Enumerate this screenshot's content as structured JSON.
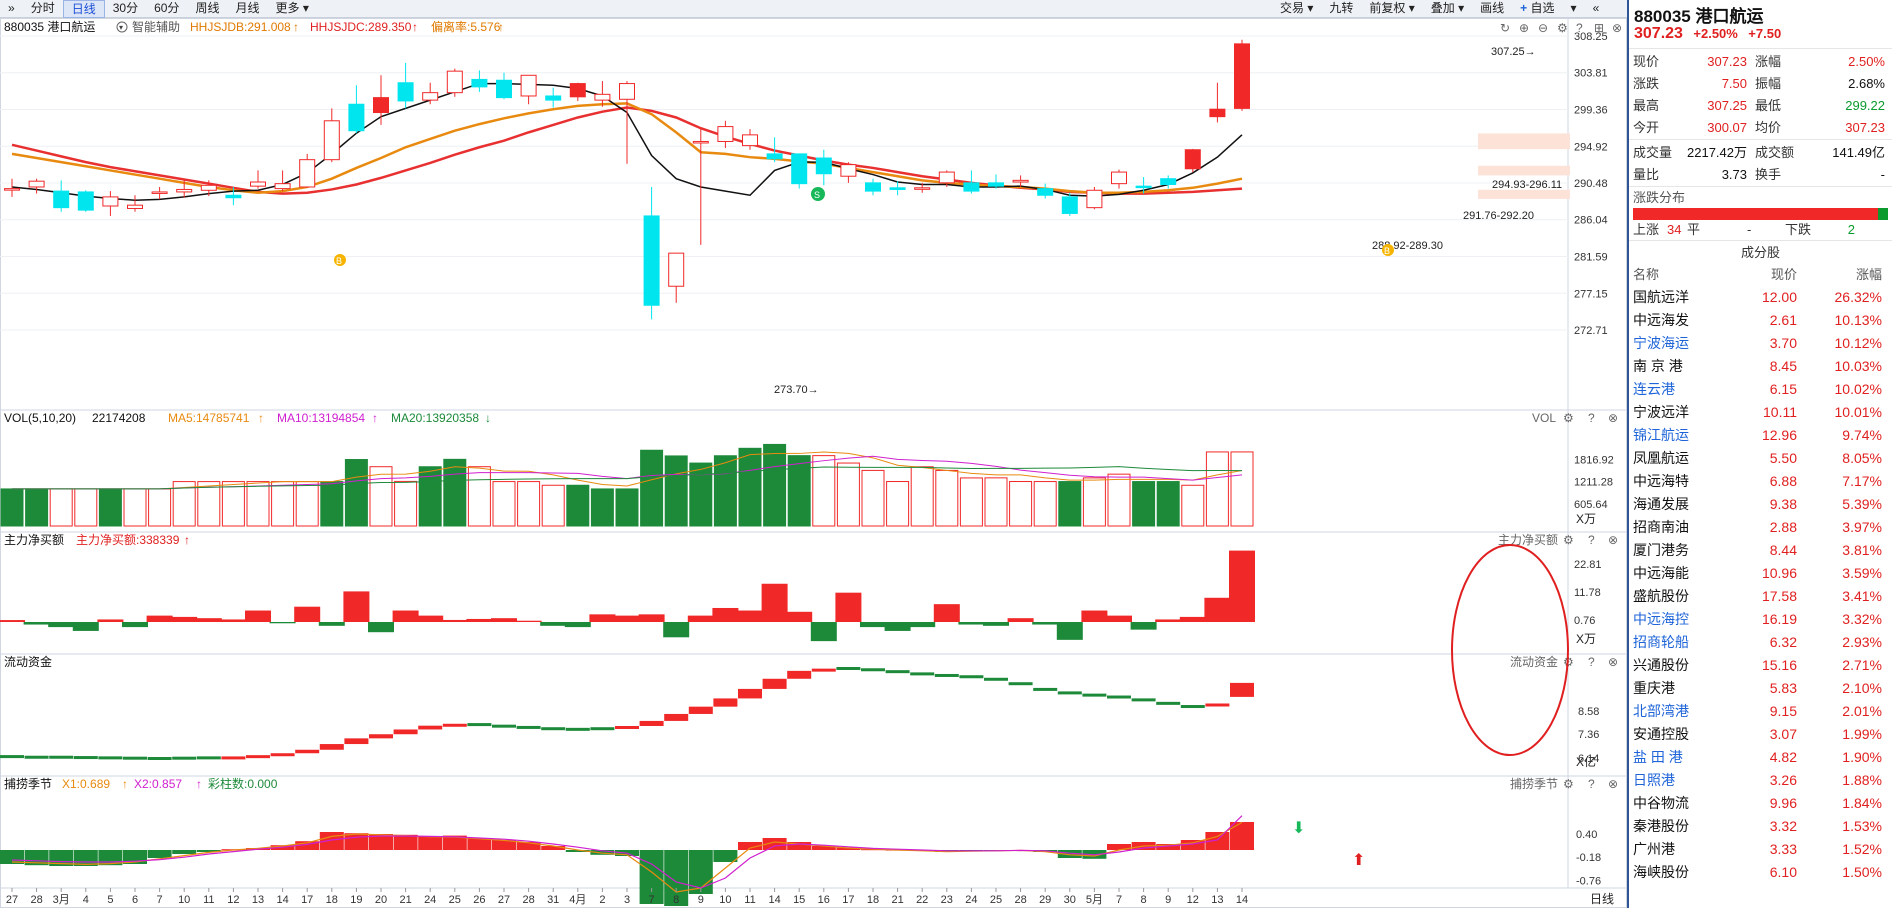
{
  "toolbar": {
    "left": [
      {
        "label": "分时",
        "active": false
      },
      {
        "label": "日线",
        "active": true
      },
      {
        "label": "30分",
        "active": false
      },
      {
        "label": "60分",
        "active": false
      },
      {
        "label": "周线",
        "active": false
      },
      {
        "label": "月线",
        "active": false
      },
      {
        "label": "更多",
        "active": false
      }
    ],
    "right": [
      "交易",
      "九转",
      "前复权",
      "叠加",
      "画线",
      "自选"
    ]
  },
  "main": {
    "code_name": "880035 港口航运",
    "assist": "智能辅助",
    "indicators": [
      {
        "label": "HHJSJDB:291.008",
        "color": "#e07a00"
      },
      {
        "label": "HHJSJDC:289.350",
        "color": "#e02020"
      },
      {
        "label": "偏离率:5.576",
        "color": "#e07a00"
      }
    ],
    "y_ticks": [
      "308.25",
      "303.81",
      "299.36",
      "294.92",
      "290.48",
      "286.04",
      "281.59",
      "277.15",
      "272.71"
    ],
    "annotations": {
      "high": "307.25",
      "low": "273.70",
      "zone1": "294.93-296.11",
      "zone2": "291.76-292.20",
      "zone3": "288.92-289.30",
      "buy": "B",
      "sell": "S"
    }
  },
  "vol": {
    "title": "VOL(5,10,20)",
    "value": "22174208",
    "ma5": "MA5:14785741",
    "ma10": "MA10:13194854",
    "ma20": "MA20:13920358",
    "right_label": "VOL",
    "y_ticks": [
      "1816.92",
      "1211.28",
      "605.64"
    ],
    "unit": "X万"
  },
  "net_buy": {
    "title": "主力净买额",
    "value": "主力净买额:338339",
    "right_label": "主力净买额",
    "y_ticks": [
      "22.81",
      "11.78",
      "0.76"
    ],
    "unit": "X万"
  },
  "flow": {
    "title": "流动资金",
    "right_label": "流动资金",
    "y_ticks": [
      "8.58",
      "7.36",
      "6.14"
    ],
    "unit": "X亿"
  },
  "season": {
    "title": "捕捞季节",
    "x1": "X1:0.689",
    "x2": "X2:0.857",
    "bars": "彩柱数:0.000",
    "right_label": "捕捞季节",
    "y_ticks": [
      "0.40",
      "-0.18",
      "-0.76"
    ]
  },
  "x_axis": {
    "labels": [
      "27",
      "28",
      "3月",
      "4",
      "5",
      "6",
      "7",
      "10",
      "11",
      "12",
      "13",
      "14",
      "17",
      "18",
      "19",
      "20",
      "21",
      "24",
      "25",
      "26",
      "27",
      "28",
      "31",
      "4月",
      "2",
      "3",
      "7",
      "8",
      "9",
      "10",
      "11",
      "14",
      "15",
      "16",
      "17",
      "18",
      "21",
      "22",
      "23",
      "24",
      "25",
      "28",
      "29",
      "30",
      "5月",
      "7",
      "8",
      "9",
      "12",
      "13",
      "14"
    ],
    "period": "日线"
  },
  "chart_data": {
    "type": "candlestick",
    "dates": [
      "27",
      "28",
      "3月",
      "4",
      "5",
      "6",
      "7",
      "10",
      "11",
      "12",
      "13",
      "14",
      "17",
      "18",
      "19",
      "20",
      "21",
      "24",
      "25",
      "26",
      "27",
      "28",
      "31",
      "4月",
      "2",
      "3",
      "7",
      "8",
      "9",
      "10",
      "11",
      "14",
      "15",
      "16",
      "17",
      "18",
      "21",
      "22",
      "23",
      "24",
      "25",
      "28",
      "29",
      "30",
      "5月",
      "7",
      "8",
      "9",
      "12",
      "13",
      "14"
    ],
    "open": [
      289.8,
      290.0,
      289.5,
      289.4,
      287.7,
      287.4,
      289.3,
      289.4,
      289.6,
      289.0,
      290.1,
      289.8,
      290.0,
      293.3,
      300.0,
      299.0,
      302.6,
      300.5,
      301.4,
      303.0,
      302.9,
      301.0,
      301.0,
      300.9,
      300.5,
      300.6,
      286.5,
      278.0,
      295.5,
      295.5,
      295.0,
      294.0,
      294.0,
      293.5,
      291.3,
      290.5,
      289.9,
      289.8,
      290.5,
      290.5,
      290.5,
      290.6,
      289.8,
      288.8,
      287.5,
      290.4,
      290.1,
      291.0,
      292.2,
      298.5,
      299.5
    ],
    "close": [
      289.8,
      290.7,
      287.5,
      287.2,
      288.8,
      287.8,
      289.4,
      289.7,
      290.2,
      288.7,
      290.6,
      290.4,
      293.3,
      298.0,
      296.8,
      300.8,
      300.4,
      301.4,
      304.0,
      302.1,
      300.8,
      303.5,
      300.5,
      302.5,
      301.2,
      302.5,
      275.7,
      282.0,
      295.5,
      297.3,
      296.3,
      293.4,
      290.4,
      291.6,
      292.7,
      289.5,
      289.7,
      289.9,
      291.8,
      289.5,
      290.1,
      290.8,
      289.0,
      286.8,
      289.6,
      291.8,
      290.0,
      290.3,
      294.5,
      299.4,
      307.3
    ],
    "high": [
      291.0,
      291.0,
      290.8,
      289.6,
      289.5,
      289.0,
      290.0,
      290.8,
      290.8,
      290.0,
      292.0,
      292.0,
      294.0,
      299.5,
      302.3,
      303.5,
      305.0,
      302.6,
      304.3,
      304.1,
      303.8,
      303.5,
      302.0,
      302.6,
      302.8,
      302.8,
      290.0,
      282.0,
      297.0,
      298.0,
      297.0,
      296.0,
      294.0,
      294.5,
      293.0,
      291.0,
      290.7,
      290.5,
      292.0,
      292.0,
      291.5,
      291.4,
      290.4,
      289.3,
      290.0,
      292.1,
      291.2,
      291.4,
      294.6,
      302.6,
      307.8
    ],
    "low": [
      288.8,
      289.2,
      287.0,
      287.0,
      286.5,
      287.0,
      288.5,
      288.7,
      288.9,
      287.8,
      289.8,
      289.5,
      289.9,
      293.0,
      296.5,
      297.5,
      299.5,
      300.0,
      300.9,
      301.5,
      300.6,
      300.0,
      299.6,
      300.4,
      299.7,
      292.8,
      274.0,
      276.0,
      283.0,
      294.7,
      294.5,
      293.0,
      289.8,
      290.2,
      290.5,
      289.0,
      289.0,
      289.3,
      290.0,
      289.2,
      289.8,
      290.0,
      288.6,
      286.5,
      287.3,
      289.8,
      289.2,
      289.8,
      291.8,
      297.8,
      299.2
    ],
    "ma_black": [
      290.0,
      289.7,
      289.3,
      288.9,
      288.6,
      288.4,
      288.5,
      288.8,
      289.2,
      289.5,
      289.6,
      290.3,
      291.7,
      294.0,
      296.5,
      298.5,
      299.5,
      300.5,
      301.5,
      302.5,
      302.5,
      302.4,
      302.3,
      301.9,
      301.0,
      299.0,
      293.8,
      291.0,
      290.0,
      289.5,
      289.0,
      292.0,
      293.0,
      293.0,
      292.2,
      291.5,
      290.6,
      290.3,
      290.3,
      290.0,
      290.0,
      290.1,
      289.7,
      289.0,
      288.9,
      289.1,
      289.6,
      290.3,
      291.7,
      293.6,
      296.3
    ],
    "ma_orange": [
      294.0,
      293.5,
      293.0,
      292.5,
      292.0,
      291.5,
      291.0,
      290.5,
      290.0,
      289.6,
      289.3,
      289.5,
      290.0,
      291.0,
      292.3,
      293.5,
      294.8,
      295.8,
      296.8,
      297.6,
      298.3,
      298.9,
      299.4,
      299.8,
      300.0,
      300.1,
      298.8,
      296.6,
      294.2,
      294.0,
      293.6,
      293.4,
      293.1,
      292.8,
      292.3,
      291.8,
      291.3,
      290.8,
      290.5,
      290.3,
      290.1,
      290.0,
      289.8,
      289.5,
      289.3,
      289.3,
      289.4,
      289.6,
      289.9,
      290.4,
      291.0
    ],
    "ma_red": [
      295.1,
      294.4,
      293.7,
      293.0,
      292.4,
      291.9,
      291.4,
      290.9,
      290.4,
      289.9,
      289.4,
      289.2,
      289.3,
      289.7,
      290.3,
      291.1,
      292.0,
      292.9,
      293.9,
      294.8,
      295.6,
      296.6,
      297.5,
      298.4,
      299.1,
      299.6,
      299.2,
      298.4,
      297.1,
      296.1,
      295.2,
      294.4,
      293.8,
      293.2,
      292.7,
      292.3,
      291.8,
      291.3,
      290.9,
      290.5,
      290.2,
      289.9,
      289.7,
      289.4,
      289.3,
      289.2,
      289.2,
      289.3,
      289.4,
      289.6,
      289.8
    ],
    "volume_wan": [
      1011,
      1011,
      1011,
      1011,
      1011,
      1011,
      1011,
      1211,
      1211,
      1211,
      1211,
      1211,
      1211,
      1211,
      1813,
      1617,
      1216,
      1616,
      1818,
      1617,
      1211,
      1211,
      1111,
      1111,
      1011,
      1011,
      2066,
      1911,
      1716,
      1916,
      2119,
      2225,
      1919,
      1919,
      1717,
      1516,
      1213,
      1615,
      1516,
      1311,
      1313,
      1213,
      1212,
      1212,
      1312,
      1414,
      1212,
      1212,
      1111,
      2020,
      2020
    ],
    "vol_up": [
      false,
      false,
      true,
      true,
      false,
      true,
      true,
      true,
      true,
      true,
      true,
      true,
      true,
      false,
      false,
      true,
      true,
      false,
      false,
      true,
      true,
      true,
      true,
      false,
      false,
      false,
      false,
      false,
      false,
      false,
      false,
      false,
      false,
      true,
      true,
      true,
      true,
      true,
      true,
      true,
      true,
      true,
      true,
      false,
      true,
      true,
      false,
      false,
      true,
      true,
      true
    ],
    "net_buy_wan": [
      0.76,
      -1.0,
      -2.0,
      -3.5,
      1.0,
      -2.0,
      2.5,
      2.0,
      1.5,
      1.0,
      4.5,
      -0.5,
      6.0,
      -1.5,
      12.0,
      -4.0,
      4.5,
      2.5,
      0.8,
      1.2,
      1.5,
      0.5,
      -1.5,
      -2.0,
      3.0,
      2.5,
      3.0,
      -6.0,
      2.5,
      5.5,
      4.5,
      15.0,
      4.0,
      -7.5,
      11.5,
      -2.0,
      -3.5,
      -2.0,
      7.0,
      -1.0,
      -1.5,
      1.5,
      -1.0,
      -7.0,
      4.5,
      2.5,
      -3.0,
      1.0,
      2.0,
      9.5,
      28.0
    ],
    "flow_yi": [
      5.84,
      5.82,
      5.82,
      5.81,
      5.8,
      5.79,
      5.78,
      5.79,
      5.8,
      5.83,
      5.87,
      5.93,
      6.04,
      6.22,
      6.4,
      6.53,
      6.68,
      6.8,
      6.86,
      6.85,
      6.8,
      6.76,
      6.72,
      6.7,
      6.72,
      6.79,
      6.95,
      7.17,
      7.4,
      7.66,
      7.96,
      8.28,
      8.53,
      8.6,
      8.62,
      8.58,
      8.52,
      8.45,
      8.4,
      8.36,
      8.28,
      8.14,
      7.96,
      7.85,
      7.78,
      7.72,
      7.63,
      7.52,
      7.42,
      7.5,
      8.15
    ],
    "season_bars": [
      -0.35,
      -0.38,
      -0.4,
      -0.4,
      -0.38,
      -0.35,
      -0.2,
      -0.1,
      -0.05,
      0.02,
      0.05,
      0.12,
      0.22,
      0.45,
      0.42,
      0.4,
      0.38,
      0.35,
      0.36,
      0.3,
      0.25,
      0.2,
      0.1,
      -0.05,
      -0.12,
      -0.15,
      -1.35,
      -1.4,
      -1.1,
      -0.3,
      0.2,
      0.3,
      0.2,
      0.1,
      0.06,
      0.02,
      0.01,
      -0.01,
      -0.05,
      -0.03,
      -0.02,
      -0.01,
      -0.05,
      -0.2,
      -0.22,
      0.15,
      0.2,
      0.15,
      0.25,
      0.45,
      0.7
    ],
    "season_x1": [
      -0.3,
      -0.32,
      -0.34,
      -0.36,
      -0.34,
      -0.3,
      -0.22,
      -0.14,
      -0.06,
      0.0,
      0.04,
      0.1,
      0.18,
      0.34,
      0.4,
      0.38,
      0.36,
      0.33,
      0.32,
      0.28,
      0.24,
      0.18,
      0.1,
      0.0,
      -0.08,
      -0.12,
      -0.55,
      -1.05,
      -0.95,
      -0.45,
      0.05,
      0.2,
      0.15,
      0.1,
      0.05,
      0.02,
      0.0,
      -0.02,
      -0.04,
      -0.03,
      -0.02,
      -0.01,
      -0.04,
      -0.12,
      -0.15,
      0.0,
      0.1,
      0.12,
      0.18,
      0.34,
      0.69
    ],
    "season_x2": [
      -0.25,
      -0.27,
      -0.29,
      -0.3,
      -0.3,
      -0.28,
      -0.24,
      -0.18,
      -0.1,
      -0.04,
      0.02,
      0.07,
      0.14,
      0.25,
      0.32,
      0.35,
      0.35,
      0.34,
      0.33,
      0.3,
      0.27,
      0.22,
      0.15,
      0.07,
      -0.02,
      -0.08,
      -0.35,
      -0.8,
      -0.95,
      -0.7,
      -0.2,
      0.1,
      0.15,
      0.12,
      0.08,
      0.04,
      0.02,
      0.0,
      -0.02,
      -0.02,
      -0.02,
      -0.01,
      -0.02,
      -0.08,
      -0.12,
      -0.05,
      0.05,
      0.1,
      0.15,
      0.25,
      0.857
    ]
  },
  "quote": {
    "code_name": "880035 港口航运",
    "price": "307.23",
    "change_pct": "+2.50%",
    "change": "+7.50",
    "rows": [
      {
        "k1": "现价",
        "v1": "307.23",
        "c1": "red",
        "k2": "涨幅",
        "v2": "2.50%",
        "c2": "red"
      },
      {
        "k1": "涨跌",
        "v1": "7.50",
        "c1": "red",
        "k2": "振幅",
        "v2": "2.68%",
        "c2": "black"
      },
      {
        "k1": "最高",
        "v1": "307.25",
        "c1": "red",
        "k2": "最低",
        "v2": "299.22",
        "c2": "green"
      },
      {
        "k1": "今开",
        "v1": "300.07",
        "c1": "red",
        "k2": "均价",
        "v2": "307.23",
        "c2": "red"
      }
    ],
    "rows2": [
      {
        "k1": "成交量",
        "v1": "2217.42万",
        "c1": "black",
        "k2": "成交额",
        "v2": "141.49亿",
        "c2": "black"
      },
      {
        "k1": "量比",
        "v1": "3.73",
        "c1": "black",
        "k2": "换手",
        "v2": "-",
        "c2": "black"
      }
    ]
  },
  "distribution": {
    "title": "涨跌分布",
    "up_label": "上涨",
    "up_count": "34",
    "flat_label": "平",
    "flat_count": "-",
    "down_label": "下跌",
    "down_count": "2"
  },
  "components": {
    "title": "成分股",
    "headers": [
      "名称",
      "现价",
      "涨幅"
    ],
    "rows": [
      {
        "name": "国航远洋",
        "price": "12.00",
        "pct": "26.32%",
        "link": false
      },
      {
        "name": "中远海发",
        "price": "2.61",
        "pct": "10.13%",
        "link": false
      },
      {
        "name": "宁波海运",
        "price": "3.70",
        "pct": "10.12%",
        "link": true
      },
      {
        "name": "南 京 港",
        "price": "8.45",
        "pct": "10.03%",
        "link": false
      },
      {
        "name": "连云港",
        "price": "6.15",
        "pct": "10.02%",
        "link": true
      },
      {
        "name": "宁波远洋",
        "price": "10.11",
        "pct": "10.01%",
        "link": false
      },
      {
        "name": "锦江航运",
        "price": "12.96",
        "pct": "9.74%",
        "link": true
      },
      {
        "name": "凤凰航运",
        "price": "5.50",
        "pct": "8.05%",
        "link": false
      },
      {
        "name": "中远海特",
        "price": "6.88",
        "pct": "7.17%",
        "link": false
      },
      {
        "name": "海通发展",
        "price": "9.38",
        "pct": "5.39%",
        "link": false
      },
      {
        "name": "招商南油",
        "price": "2.88",
        "pct": "3.97%",
        "link": false
      },
      {
        "name": "厦门港务",
        "price": "8.44",
        "pct": "3.81%",
        "link": false
      },
      {
        "name": "中远海能",
        "price": "10.96",
        "pct": "3.59%",
        "link": false
      },
      {
        "name": "盛航股份",
        "price": "17.58",
        "pct": "3.41%",
        "link": false
      },
      {
        "name": "中远海控",
        "price": "16.19",
        "pct": "3.32%",
        "link": true
      },
      {
        "name": "招商轮船",
        "price": "6.32",
        "pct": "2.93%",
        "link": true
      },
      {
        "name": "兴通股份",
        "price": "15.16",
        "pct": "2.71%",
        "link": false
      },
      {
        "name": "重庆港",
        "price": "5.83",
        "pct": "2.10%",
        "link": false
      },
      {
        "name": "北部湾港",
        "price": "9.15",
        "pct": "2.01%",
        "link": true
      },
      {
        "name": "安通控股",
        "price": "3.07",
        "pct": "1.99%",
        "link": false
      },
      {
        "name": "盐 田 港",
        "price": "4.82",
        "pct": "1.90%",
        "link": true
      },
      {
        "name": "日照港",
        "price": "3.26",
        "pct": "1.88%",
        "link": true
      },
      {
        "name": "中谷物流",
        "price": "9.96",
        "pct": "1.84%",
        "link": false
      },
      {
        "name": "秦港股份",
        "price": "3.32",
        "pct": "1.53%",
        "link": false
      },
      {
        "name": "广州港",
        "price": "3.33",
        "pct": "1.52%",
        "link": false
      },
      {
        "name": "海峡股份",
        "price": "6.10",
        "pct": "1.50%",
        "link": false
      }
    ]
  },
  "colors": {
    "up": "#f02828",
    "down": "#00e5ee",
    "vol_down": "#1d8a3a",
    "ma_black": "#111111",
    "ma_orange": "#e88a10",
    "ma_red": "#e83030",
    "flow_green": "#1d8a3a",
    "highlight": "#e02020",
    "accent": "#1e64d8"
  }
}
